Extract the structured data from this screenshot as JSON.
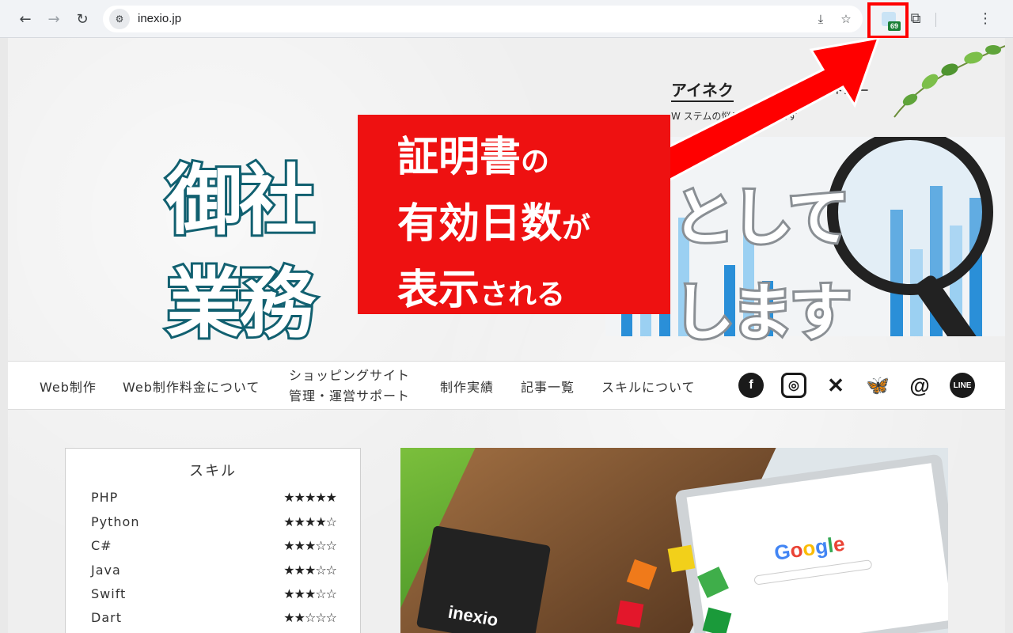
{
  "browser": {
    "url": "inexio.jp",
    "extension_badge": "69"
  },
  "site": {
    "title": "アイネク",
    "title_suffix": "のサイトドクター",
    "description": "W         ステムの悩みを解決します"
  },
  "hero": {
    "line1_a": "御社",
    "line1_b": "として",
    "line2_a": "業務",
    "line2_b": "します"
  },
  "callout": {
    "line1_big": "証明書",
    "line1_small": "の",
    "line2_big": "有効日数",
    "line2_small": "が",
    "line3_big": "表示",
    "line3_small": "される",
    "color": "#ee1111"
  },
  "nav": {
    "items": [
      {
        "label": "Web制作"
      },
      {
        "label": "Web制作料金について"
      },
      {
        "label": "ショッピングサイト",
        "label2": "管理・運営サポート"
      },
      {
        "label": "制作実績"
      },
      {
        "label": "記事一覧"
      },
      {
        "label": "スキルについて"
      }
    ],
    "social": [
      "facebook-icon",
      "instagram-icon",
      "x-icon",
      "bluesky-icon",
      "threads-icon",
      "line-icon"
    ],
    "line_label": "LINE"
  },
  "skills": {
    "title": "スキル",
    "rows": [
      {
        "name": "PHP",
        "stars": "★★★★★"
      },
      {
        "name": "Python",
        "stars": "★★★★☆"
      },
      {
        "name": "C#",
        "stars": "★★★☆☆"
      },
      {
        "name": "Java",
        "stars": "★★★☆☆"
      },
      {
        "name": "Swift",
        "stars": "★★★☆☆"
      },
      {
        "name": "Dart",
        "stars": "★★☆☆☆"
      }
    ]
  },
  "feature": {
    "google_logo": "Google",
    "brand": "inexio"
  }
}
